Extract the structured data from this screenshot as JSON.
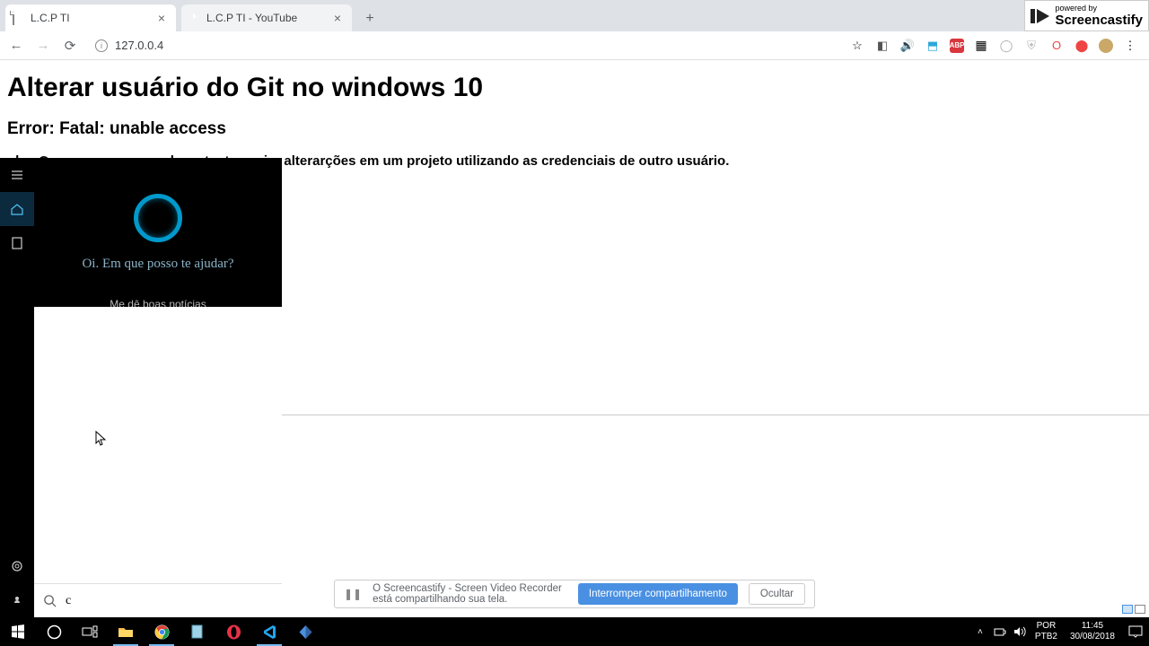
{
  "browser": {
    "tabs": [
      {
        "title": "L.C.P TI",
        "favicon": "file"
      },
      {
        "title": "L.C.P TI - YouTube",
        "favicon": "youtube"
      }
    ],
    "address": "127.0.0.4",
    "toolbar_icons": [
      "star",
      "loc",
      "vol",
      "ext1",
      "abp",
      "qr",
      "dim",
      "shield",
      "opera",
      "rec",
      "avatar",
      "menu"
    ]
  },
  "screencastify": {
    "powered_by": "powered by",
    "brand": "Screencastify"
  },
  "page": {
    "h1": "Alterar usuário do Git no windows 10",
    "h2": "Error: Fatal: unable access",
    "p": "obs. O error ocorre quando se tenta enviar alterarções em um projeto utilizando as credenciais de outro usuário."
  },
  "cortana": {
    "greeting": "Oi. Em que posso te ajudar?",
    "suggestion_partial": "Me dê boas notícias",
    "search_value": "c",
    "sidebar": [
      "menu",
      "home",
      "notebook",
      "settings",
      "feedback"
    ]
  },
  "share_bar": {
    "message": "O Screencastify - Screen Video Recorder está compartilhando sua tela.",
    "stop": "Interromper compartilhamento",
    "hide": "Ocultar"
  },
  "taskbar": {
    "tray": {
      "lang1": "POR",
      "lang2": "PTB2",
      "time": "11:45",
      "date": "30/08/2018"
    }
  }
}
